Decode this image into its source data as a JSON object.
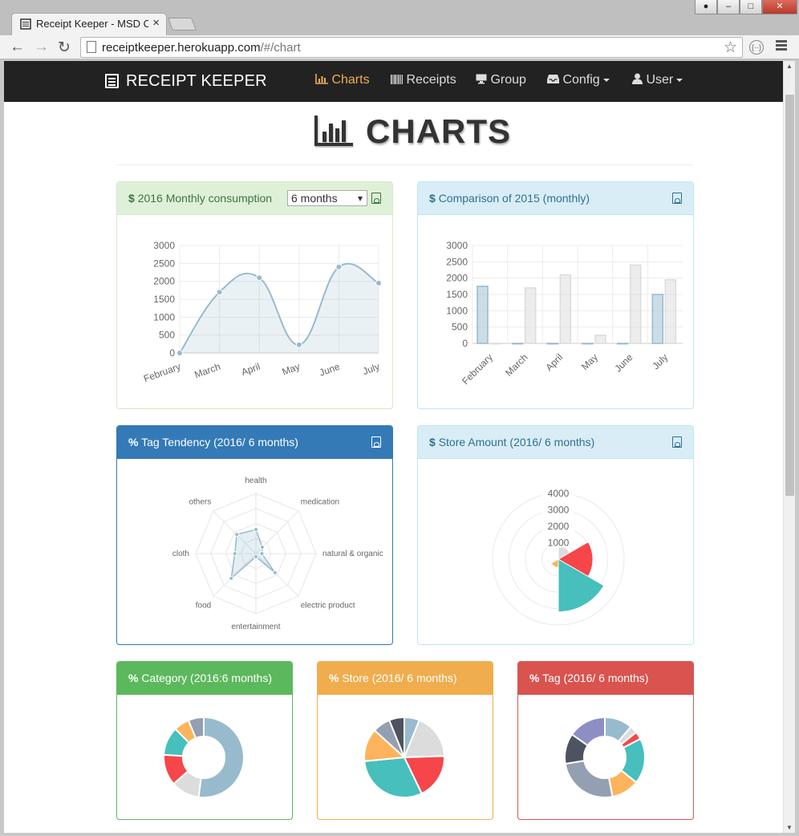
{
  "browser": {
    "tab_title": "Receipt Keeper - MSD C",
    "url_host": "receiptkeeper.herokuapp.com",
    "url_path": "/#/chart"
  },
  "navbar": {
    "brand": "RECEIPT KEEPER",
    "items": [
      {
        "label": "Charts",
        "icon": "bar-chart-icon",
        "active": true
      },
      {
        "label": "Receipts",
        "icon": "barcode-icon"
      },
      {
        "label": "Group",
        "icon": "desktop-icon"
      },
      {
        "label": "Config",
        "icon": "inbox-icon",
        "dropdown": true
      },
      {
        "label": "User",
        "icon": "user-icon",
        "dropdown": true
      }
    ]
  },
  "page_title": "CHARTS",
  "panels": {
    "monthly": {
      "symbol": "$",
      "title": "2016 Monthly consumption",
      "select_value": "6 months"
    },
    "comparison": {
      "symbol": "$",
      "title": "Comparison of 2015 (monthly)"
    },
    "tag_tendency": {
      "symbol": "%",
      "title": "Tag Tendency (2016/ 6 months)"
    },
    "store_amount": {
      "symbol": "$",
      "title": "Store Amount (2016/ 6 months)"
    },
    "category": {
      "symbol": "%",
      "title": "Category (2016:6 months)"
    },
    "store": {
      "symbol": "%",
      "title": "Store (2016/ 6 months)"
    },
    "tag": {
      "symbol": "%",
      "title": "Tag (2016/ 6 months)"
    }
  },
  "colors": {
    "line": "#97bbcd",
    "bar_2015": "#dcdcdc",
    "palette": [
      "#97bbcd",
      "#dcdcdc",
      "#f7464a",
      "#46bfbd",
      "#fdb45c",
      "#949fb1",
      "#4d5360"
    ]
  },
  "chart_data": [
    {
      "id": "monthly",
      "type": "line",
      "categories": [
        "February",
        "March",
        "April",
        "May",
        "June",
        "July"
      ],
      "values": [
        0,
        1700,
        2100,
        230,
        2400,
        1950
      ],
      "ylim": [
        0,
        3000
      ],
      "yticks": [
        0,
        500,
        1000,
        1500,
        2000,
        2500,
        3000
      ],
      "fill": true
    },
    {
      "id": "comparison",
      "type": "bar",
      "categories": [
        "February",
        "March",
        "April",
        "May",
        "June",
        "July"
      ],
      "series": [
        {
          "values": [
            1750,
            0,
            0,
            0,
            0,
            1500
          ]
        },
        {
          "values": [
            0,
            1700,
            2100,
            250,
            2400,
            1950
          ]
        }
      ],
      "ylim": [
        0,
        3000
      ],
      "yticks": [
        0,
        500,
        1000,
        1500,
        2000,
        2500,
        3000
      ]
    },
    {
      "id": "tag_tendency",
      "type": "radar",
      "categories": [
        "health",
        "medication",
        "natural & organic",
        "electric product",
        "entertainment",
        "food",
        "cloth",
        "others"
      ],
      "values": [
        40,
        15,
        10,
        45,
        5,
        58,
        35,
        45
      ],
      "max": 100
    },
    {
      "id": "store_amount",
      "type": "polar-area",
      "rticks": [
        1000,
        2000,
        3000,
        4000
      ],
      "max": 4000,
      "segments": [
        {
          "value": 800,
          "color": "#dcdcdc"
        },
        {
          "value": 2100,
          "color": "#f7464a"
        },
        {
          "value": 3200,
          "color": "#46bfbd"
        },
        {
          "value": 500,
          "color": "#fdb45c"
        },
        {
          "value": 80,
          "color": "#949fb1"
        },
        {
          "value": 40,
          "color": "#4d5360"
        }
      ]
    },
    {
      "id": "category",
      "type": "pie",
      "donut": true,
      "slices": [
        {
          "value": 50,
          "color": "#97bbcd"
        },
        {
          "value": 11,
          "color": "#dcdcdc"
        },
        {
          "value": 12,
          "color": "#f7464a"
        },
        {
          "value": 11,
          "color": "#46bfbd"
        },
        {
          "value": 6,
          "color": "#fdb45c"
        },
        {
          "value": 6,
          "color": "#949fb1"
        }
      ]
    },
    {
      "id": "store",
      "type": "pie",
      "donut": false,
      "slices": [
        {
          "value": 6,
          "color": "#97bbcd"
        },
        {
          "value": 18,
          "color": "#dcdcdc"
        },
        {
          "value": 18,
          "color": "#f7464a"
        },
        {
          "value": 30,
          "color": "#46bfbd"
        },
        {
          "value": 13,
          "color": "#fdb45c"
        },
        {
          "value": 7,
          "color": "#949fb1"
        },
        {
          "value": 6,
          "color": "#4d5360"
        }
      ]
    },
    {
      "id": "tag",
      "type": "pie",
      "donut": true,
      "slices": [
        {
          "value": 11,
          "color": "#97bbcd"
        },
        {
          "value": 3,
          "color": "#dcdcdc"
        },
        {
          "value": 3,
          "color": "#f7464a"
        },
        {
          "value": 18,
          "color": "#46bfbd"
        },
        {
          "value": 11,
          "color": "#fdb45c"
        },
        {
          "value": 25,
          "color": "#949fb1"
        },
        {
          "value": 12,
          "color": "#4d5360"
        },
        {
          "value": 15,
          "color": "#8c8ec4"
        }
      ]
    }
  ]
}
